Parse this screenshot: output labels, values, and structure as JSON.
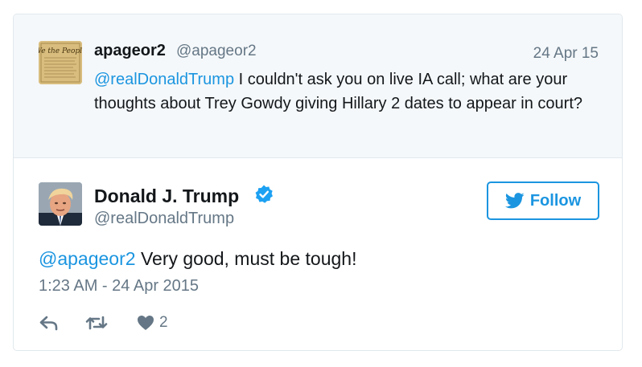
{
  "quoted_tweet": {
    "display_name": "apageor2",
    "handle": "@apageor2",
    "date": "24 Apr 15",
    "mention": "@realDonaldTrump",
    "text": " I couldn't ask you on live IA call; what are your thoughts about Trey Gowdy giving Hillary 2 dates to appear in court?"
  },
  "tweet": {
    "display_name": "Donald J. Trump",
    "handle": "@realDonaldTrump",
    "verified_icon": "verified-badge-icon",
    "follow_label": "Follow",
    "mention": "@apageor2",
    "text": " Very good, must be tough!",
    "timestamp": "1:23 AM - 24 Apr 2015",
    "like_count": "2"
  },
  "colors": {
    "accent": "#1b95e0",
    "text": "#14171a",
    "muted": "#657786",
    "quoted_bg": "#f5f8fa",
    "border": "#e1e8ed"
  }
}
